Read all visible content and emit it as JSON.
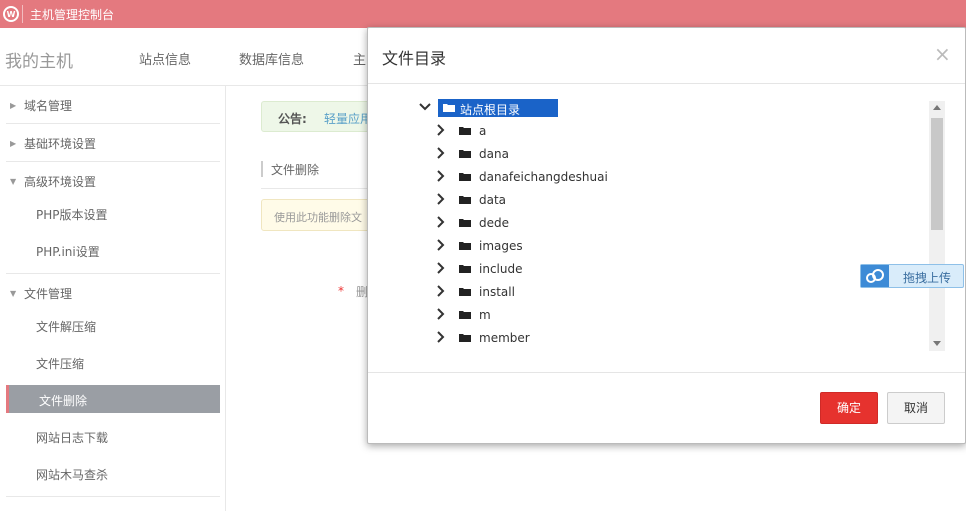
{
  "topbar": {
    "title": "主机管理控制台",
    "logo_text": "ⓦ"
  },
  "nav": {
    "my_host": "我的主机",
    "tabs": [
      "站点信息",
      "数据库信息",
      "主"
    ]
  },
  "sidebar": {
    "groups": [
      {
        "label": "域名管理"
      },
      {
        "label": "基础环境设置"
      },
      {
        "label": "高级环境设置"
      },
      {
        "label": "文件管理"
      }
    ],
    "advanced_items": [
      "PHP版本设置",
      "PHP.ini设置"
    ],
    "file_items": [
      "文件解压缩",
      "文件压缩",
      "文件删除",
      "网站日志下载",
      "网站木马查杀"
    ]
  },
  "content": {
    "notice_label": "公告:",
    "notice_text": "轻量应用",
    "section_title": "文件删除",
    "warn_text": "使用此功能删除文",
    "required_star": "*",
    "required_label": "删"
  },
  "dialog": {
    "title": "文件目录",
    "close": "×",
    "root": "站点根目录",
    "folders": [
      "a",
      "dana",
      "danafeichangdeshuai",
      "data",
      "dede",
      "images",
      "include",
      "install",
      "m",
      "member"
    ],
    "ok_label": "确定",
    "cancel_label": "取消"
  },
  "upload": {
    "label": "拖拽上传"
  },
  "colors": {
    "topbar": "#e4797f",
    "ok_button": "#e6322e",
    "selection": "#1a63c8",
    "active_item": "#9a9ea4"
  }
}
